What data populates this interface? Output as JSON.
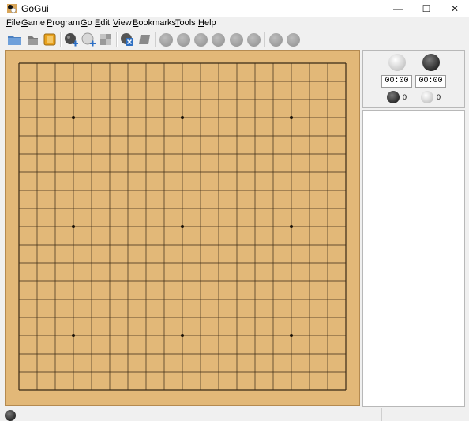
{
  "window": {
    "title": "GoGui",
    "minimize": "—",
    "maximize": "☐",
    "close": "✕"
  },
  "menu": [
    {
      "underline": "F",
      "rest": "ile"
    },
    {
      "underline": "G",
      "rest": "ame"
    },
    {
      "underline": "P",
      "rest": "rogram"
    },
    {
      "underline": "G",
      "rest": "o"
    },
    {
      "underline": "E",
      "rest": "dit"
    },
    {
      "underline": "V",
      "rest": "iew"
    },
    {
      "underline": "B",
      "rest": "ookmarks"
    },
    {
      "underline": "T",
      "rest": "ools"
    },
    {
      "underline": "H",
      "rest": "elp"
    }
  ],
  "toolbar": {
    "icons": [
      "open-icon",
      "save-icon",
      "export-icon",
      "new-game-icon",
      "add-stone-icon",
      "setup-icon",
      "delete-icon",
      "pass-icon",
      "beginning-icon",
      "backward-10-icon",
      "backward-icon",
      "forward-icon",
      "forward-10-icon",
      "end-icon",
      "previous-variation-icon",
      "next-variation-icon"
    ]
  },
  "board": {
    "size": 19,
    "star_points": [
      [
        3,
        3
      ],
      [
        3,
        9
      ],
      [
        3,
        15
      ],
      [
        9,
        3
      ],
      [
        9,
        9
      ],
      [
        9,
        15
      ],
      [
        15,
        3
      ],
      [
        15,
        9
      ],
      [
        15,
        15
      ]
    ],
    "color": "#e2b878"
  },
  "clocks": {
    "white_time": "00:00",
    "black_time": "00:00"
  },
  "captures": {
    "black": "0",
    "white": "0"
  },
  "status": {
    "to_move": "black"
  }
}
